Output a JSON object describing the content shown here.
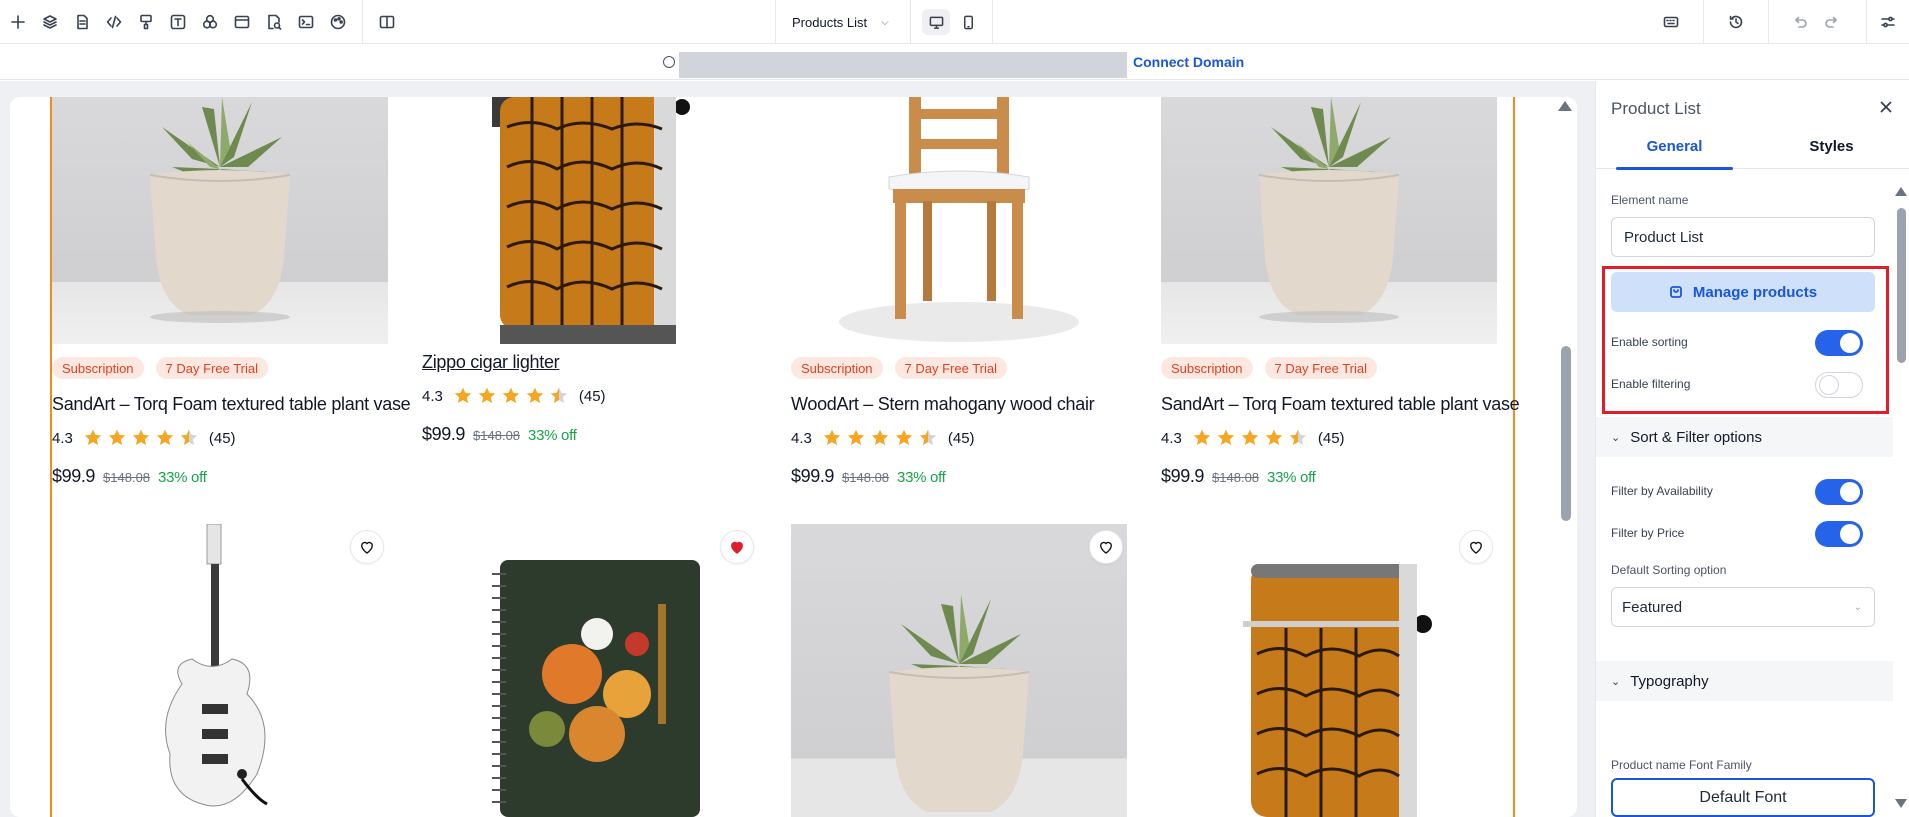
{
  "toolbar": {
    "page_name": "Products List",
    "left_icons": [
      "add-icon",
      "layers-icon",
      "pages-icon",
      "code-icon",
      "paint-icon",
      "text-icon",
      "shapes-icon",
      "layout-icon",
      "inspect-icon",
      "terminal-icon",
      "theme-icon"
    ],
    "right_icons": [
      "keyboard-icon",
      "history-icon",
      "undo-icon",
      "redo-icon",
      "settings-icon"
    ]
  },
  "urlbar": {
    "connect_label": "Connect Domain"
  },
  "products": [
    {
      "badges": [
        "Subscription",
        "7 Day Free Trial"
      ],
      "name": "SandArt – Torq Foam textured table plant vase",
      "rating": "4.3",
      "stars": 4.5,
      "reviews": "(45)",
      "price": "$99.9",
      "old_price": "$148.08",
      "discount": "33% off",
      "image": "plant-vase"
    },
    {
      "badges": [],
      "name": "Zippo cigar lighter",
      "rating": "4.3",
      "stars": 4.5,
      "reviews": "(45)",
      "price": "$99.9",
      "old_price": "$148.08",
      "discount": "33% off",
      "image": "lighter"
    },
    {
      "badges": [
        "Subscription",
        "7 Day Free Trial"
      ],
      "name": "WoodArt – Stern mahogany wood chair",
      "rating": "4.3",
      "stars": 4.5,
      "reviews": "(45)",
      "price": "$99.9",
      "old_price": "$148.08",
      "discount": "33% off",
      "image": "chair"
    },
    {
      "badges": [
        "Subscription",
        "7 Day Free Trial"
      ],
      "name": "SandArt – Torq Foam textured table plant vase",
      "rating": "4.3",
      "stars": 4.5,
      "reviews": "(45)",
      "price": "$99.9",
      "old_price": "$148.08",
      "discount": "33% off",
      "image": "plant-vase"
    }
  ],
  "second_row": [
    {
      "image": "electric-guitar",
      "favorited": false
    },
    {
      "image": "notebook",
      "favorited": true
    },
    {
      "image": "plant-vase",
      "favorited": false
    },
    {
      "image": "lighter",
      "favorited": false
    }
  ],
  "panel": {
    "title": "Product List",
    "tabs": [
      "General",
      "Styles"
    ],
    "element_name_label": "Element name",
    "element_name_value": "Product List",
    "manage_products_label": "Manage products",
    "enable_sorting_label": "Enable sorting",
    "enable_sorting": true,
    "enable_filtering_label": "Enable filtering",
    "enable_filtering": false,
    "sort_filter_section": "Sort & Filter options",
    "filter_availability_label": "Filter by Availability",
    "filter_availability": true,
    "filter_price_label": "Filter by Price",
    "filter_price": true,
    "default_sorting_label": "Default Sorting option",
    "default_sorting_value": "Featured",
    "typography_section": "Typography",
    "product_name_font_label": "Product name Font Family",
    "product_name_font_value": "Default Font"
  },
  "colors": {
    "accent": "#1a56db",
    "toggle_on": "#2563eb",
    "badge_bg": "#fde8e1",
    "badge_text": "#e0401f",
    "discount": "#16a34a",
    "star": "#f5a623",
    "frame_outline": "#f28a1d",
    "highlight_box": "#e11d2a"
  }
}
